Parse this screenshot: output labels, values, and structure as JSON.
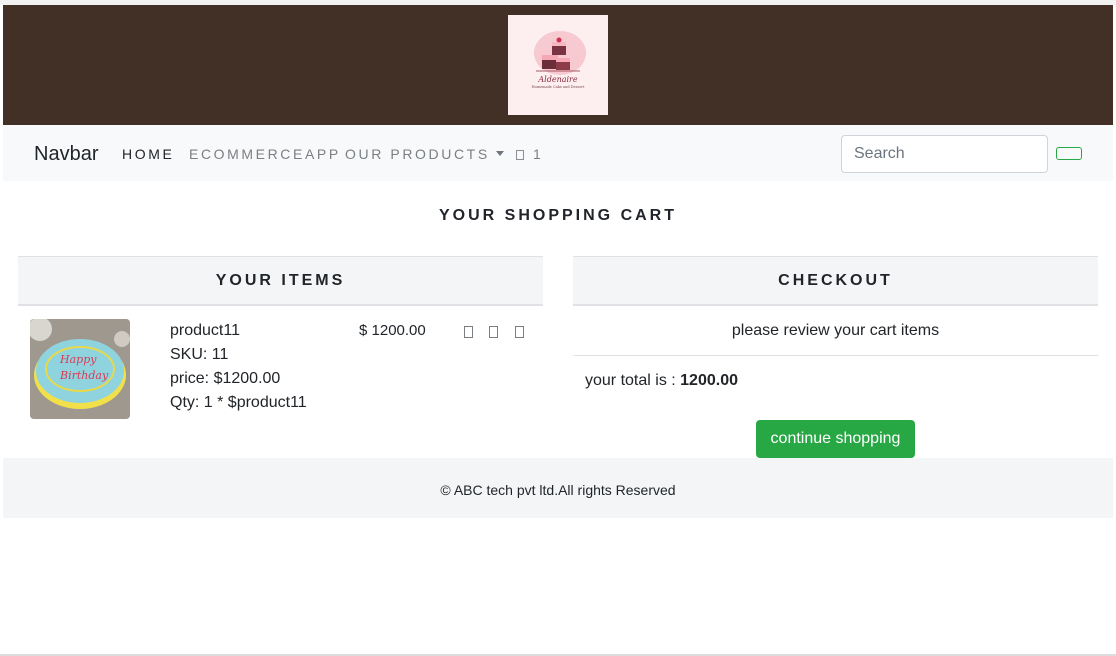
{
  "header": {
    "logo": {
      "brand": "Aldenaire",
      "tagline": "Homemade Cake and Dessert"
    }
  },
  "navbar": {
    "brand": "Navbar",
    "links": {
      "home": "HOME",
      "ecommerceapp": "ECOMMERCEAPP",
      "our_products": "OUR PRODUCTS"
    },
    "cart_count": "1",
    "search": {
      "placeholder": "Search",
      "value": ""
    }
  },
  "page": {
    "title": "YOUR SHOPPING CART"
  },
  "items_panel": {
    "header": "YOUR ITEMS",
    "items": [
      {
        "name": "product11",
        "sku": "SKU: 11",
        "price": "price: $1200.00",
        "qty": "Qty: 1 * $product11",
        "total": "$ 1200.00",
        "actions": [
          "add-icon",
          "remove-icon",
          "delete-icon"
        ]
      }
    ]
  },
  "checkout_panel": {
    "header": "CHECKOUT",
    "review_text": "please review your cart items",
    "total_label": "your total is : ",
    "total_value": "1200.00",
    "continue_label": "continue shopping"
  },
  "footer": {
    "text": "© ABC tech pvt ltd.All rights Reserved"
  },
  "colors": {
    "header_bg": "#422f25",
    "navbar_bg": "#f8f9fa",
    "card_header_bg": "#f4f5f7",
    "accent_green": "#28a745"
  }
}
